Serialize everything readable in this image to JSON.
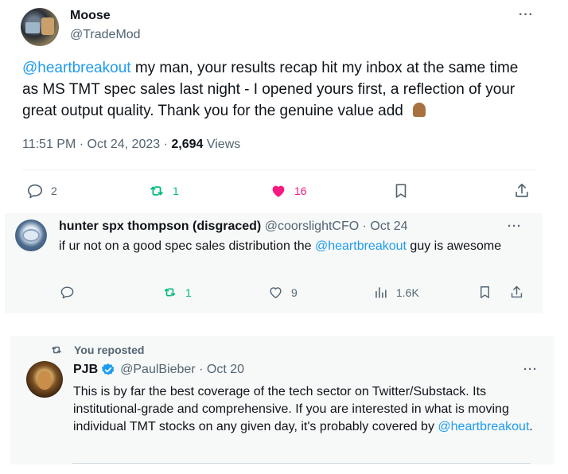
{
  "tweet1": {
    "name": "Moose",
    "handle": "@TradeMod",
    "mention": "@heartbreakout",
    "text": " my man, your results recap hit my inbox at the same time as MS TMT spec sales last night - I opened yours first, a reflection of your great output quality. Thank you for the genuine value add",
    "emoji": "folded-hands-emoji",
    "time": "11:51 PM · Oct 24, 2023 · ",
    "views_count": "2,694",
    "views_label": " Views",
    "replies": "2",
    "reposts": "1",
    "likes": "16",
    "more": "···"
  },
  "tweet2": {
    "name": "hunter spx thompson (disgraced)",
    "handle": "@coorslightCFO",
    "date": "· Oct 24",
    "text_before": "if ur not on a good spec sales distribution the ",
    "mention": "@heartbreakout",
    "text_after": " guy is awesome",
    "replies": "",
    "reposts": "1",
    "likes": "9",
    "views": "1.6K",
    "more": "···"
  },
  "tweet3": {
    "repost_label": "You reposted",
    "name": "PJB",
    "handle": "@PaulBieber",
    "date": "· Oct 20",
    "text": "This is by far the best coverage of the tech sector on Twitter/Substack. Its institutional-grade and comprehensive. If you are interested in what is moving individual TMT stocks on any given day, it's probably covered by ",
    "mention": "@heartbreakout",
    "text_end": ".",
    "more": "···"
  },
  "colors": {
    "link": "#1d9bf0",
    "repost_green": "#00ba7c",
    "like_pink": "#f91880",
    "muted": "#536471"
  }
}
